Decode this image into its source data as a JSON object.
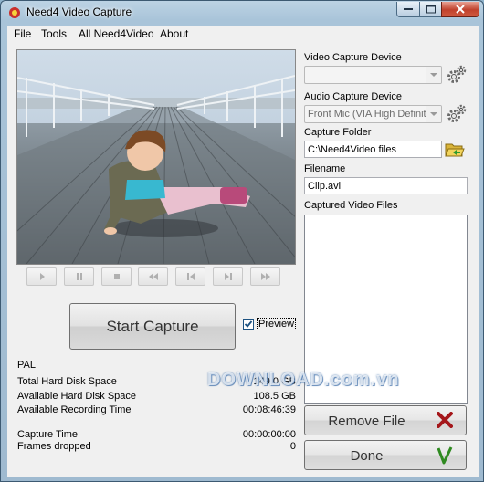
{
  "window": {
    "title": "Need4 Video Capture"
  },
  "menu": [
    "File",
    "Tools",
    "All Need4Video",
    "About"
  ],
  "transport": [
    "play-icon",
    "pause-icon",
    "stop-icon",
    "rewind-icon",
    "skip-back-icon",
    "skip-forward-icon",
    "fast-forward-icon"
  ],
  "capture": {
    "start_label": "Start Capture",
    "preview_label": "Preview",
    "preview_checked": true
  },
  "info": {
    "format": "PAL",
    "total_disk_label": "Total Hard Disk Space",
    "total_disk_value": "149.0 GB",
    "available_disk_label": "Available Hard Disk Space",
    "available_disk_value": "108.5 GB",
    "recording_time_label": "Available Recording Time",
    "recording_time_value": "00:08:46:39",
    "capture_time_label": "Capture Time",
    "capture_time_value": "00:00:00:00",
    "frames_dropped_label": "Frames dropped",
    "frames_dropped_value": "0"
  },
  "settings": {
    "video_device_label": "Video Capture Device",
    "video_device_value": "",
    "audio_device_label": "Audio Capture Device",
    "audio_device_value": "Front Mic (VIA High Definition",
    "folder_label": "Capture Folder",
    "folder_value": "C:\\Need4Video files",
    "filename_label": "Filename",
    "filename_value": "Clip.avi",
    "captured_files_label": "Captured Video Files",
    "captured_files": []
  },
  "actions": {
    "remove_label": "Remove File",
    "done_label": "Done"
  },
  "watermark": "DOWNLOAD.com.vn",
  "colors": {
    "remove_icon": "#a4161a",
    "done_icon": "#2f8a20",
    "accent": "#1c5180"
  }
}
